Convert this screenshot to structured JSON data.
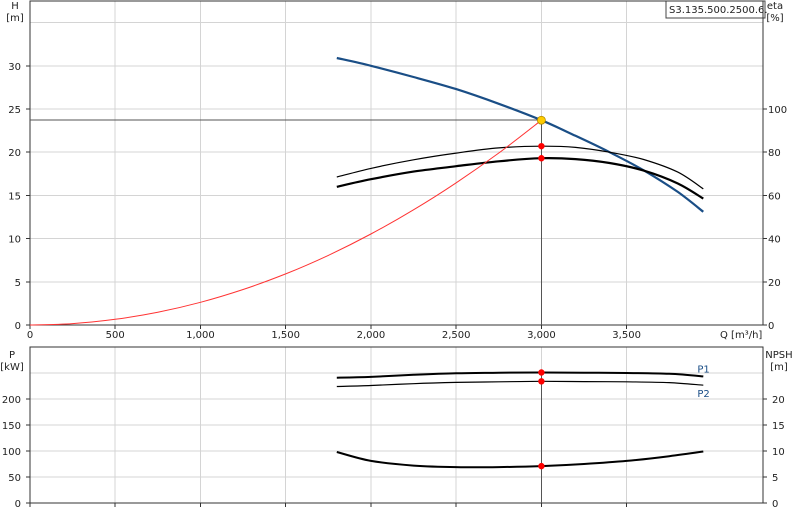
{
  "model": "S3.135.500.2500.6.",
  "colors": {
    "head": "#1a4e86",
    "eta": "#000000",
    "system": "#ff3333",
    "grid": "#d4d4d4",
    "duty_point": "#ffcc00",
    "marker": "#ff0000",
    "p_series": "#1a4e86",
    "npsh": "#000000"
  },
  "chart_data": [
    {
      "type": "line",
      "name": "top",
      "ylabel_left": [
        "H",
        "[m]"
      ],
      "ylabel_right": [
        "eta",
        "[%]"
      ],
      "xlabel": "Q [m³/h]",
      "xlim": [
        0,
        4300
      ],
      "ylim_left": [
        0,
        37.5
      ],
      "ylim_right": [
        0,
        150
      ],
      "x_ticks": [
        0,
        500,
        1000,
        1500,
        2000,
        2500,
        3000,
        3500
      ],
      "x_tick_labels": [
        "0",
        "500",
        "1,000",
        "1,500",
        "2,000",
        "2,500",
        "3,000",
        "3,500"
      ],
      "y_ticks_left": [
        0,
        5,
        10,
        15,
        20,
        25,
        30
      ],
      "y_ticks_right": [
        0,
        20,
        40,
        60,
        80,
        100
      ],
      "series": [
        {
          "key": "head",
          "axis": "left",
          "width": 2.2,
          "x": [
            1800,
            2000,
            2250,
            2500,
            2750,
            3000,
            3200,
            3400,
            3600,
            3800,
            3950
          ],
          "y": [
            30.9,
            30.0,
            28.7,
            27.3,
            25.6,
            23.7,
            21.9,
            20.0,
            17.9,
            15.4,
            13.1
          ]
        },
        {
          "key": "eta",
          "axis": "right",
          "width": 2.2,
          "x": [
            1800,
            2000,
            2250,
            2500,
            2750,
            3000,
            3200,
            3400,
            3600,
            3800,
            3950
          ],
          "y": [
            64,
            67.5,
            71,
            73.5,
            75.8,
            77.2,
            76.8,
            75,
            71.5,
            65.5,
            58.5
          ]
        },
        {
          "key": "eta",
          "axis": "right",
          "width": 1.2,
          "x": [
            1800,
            2000,
            2250,
            2500,
            2750,
            3000,
            3200,
            3400,
            3600,
            3800,
            3950
          ],
          "y": [
            68.5,
            72.5,
            76.5,
            79.6,
            82,
            82.8,
            82.2,
            80,
            76.6,
            70.8,
            63
          ]
        },
        {
          "key": "system",
          "axis": "left",
          "width": 1,
          "x": [
            0,
            250,
            500,
            750,
            1000,
            1250,
            1500,
            1750,
            2000,
            2250,
            2500,
            2750,
            3000
          ],
          "y": [
            0,
            0.16,
            0.66,
            1.48,
            2.63,
            4.11,
            5.92,
            8.06,
            10.53,
            13.33,
            16.46,
            19.91,
            23.7
          ]
        }
      ],
      "duty_point": {
        "x": 3000,
        "y": 23.7
      },
      "markers": [
        {
          "x": 3000,
          "y": 82.8,
          "axis": "right"
        },
        {
          "x": 3000,
          "y": 77.2,
          "axis": "right"
        }
      ]
    },
    {
      "type": "line",
      "name": "bottom",
      "ylabel_left": [
        "P",
        "[kW]"
      ],
      "ylabel_right": [
        "NPSH",
        "[m]"
      ],
      "xlim": [
        0,
        4300
      ],
      "ylim_left": [
        0,
        300
      ],
      "ylim_right": [
        0,
        30
      ],
      "y_ticks_left": [
        0,
        50,
        100,
        150,
        200
      ],
      "y_ticks_right": [
        0,
        5,
        10,
        15,
        20
      ],
      "series": [
        {
          "name": "P1",
          "key": "p1",
          "axis": "left",
          "width": 2,
          "x": [
            1800,
            2000,
            2250,
            2500,
            2750,
            3000,
            3250,
            3500,
            3750,
            3950
          ],
          "y": [
            241,
            242.5,
            246.5,
            249.5,
            250.5,
            251,
            250.5,
            250,
            248.5,
            243.5
          ]
        },
        {
          "name": "P2",
          "key": "p2",
          "axis": "left",
          "width": 1.2,
          "x": [
            1800,
            2000,
            2250,
            2500,
            2750,
            3000,
            3250,
            3500,
            3750,
            3950
          ],
          "y": [
            224,
            226,
            229.5,
            232,
            233,
            234,
            233.5,
            233,
            231.5,
            226.5
          ]
        },
        {
          "key": "npsh",
          "axis": "right",
          "width": 2,
          "x": [
            1800,
            2000,
            2250,
            2500,
            2750,
            3000,
            3250,
            3500,
            3750,
            3950
          ],
          "y": [
            9.8,
            8.1,
            7.2,
            6.9,
            6.9,
            7.1,
            7.5,
            8.1,
            9.0,
            9.9
          ]
        }
      ],
      "markers": [
        {
          "x": 3000,
          "y": 251,
          "axis": "left"
        },
        {
          "x": 3000,
          "y": 234,
          "axis": "left"
        },
        {
          "x": 3000,
          "y": 7.1,
          "axis": "right"
        }
      ]
    }
  ]
}
